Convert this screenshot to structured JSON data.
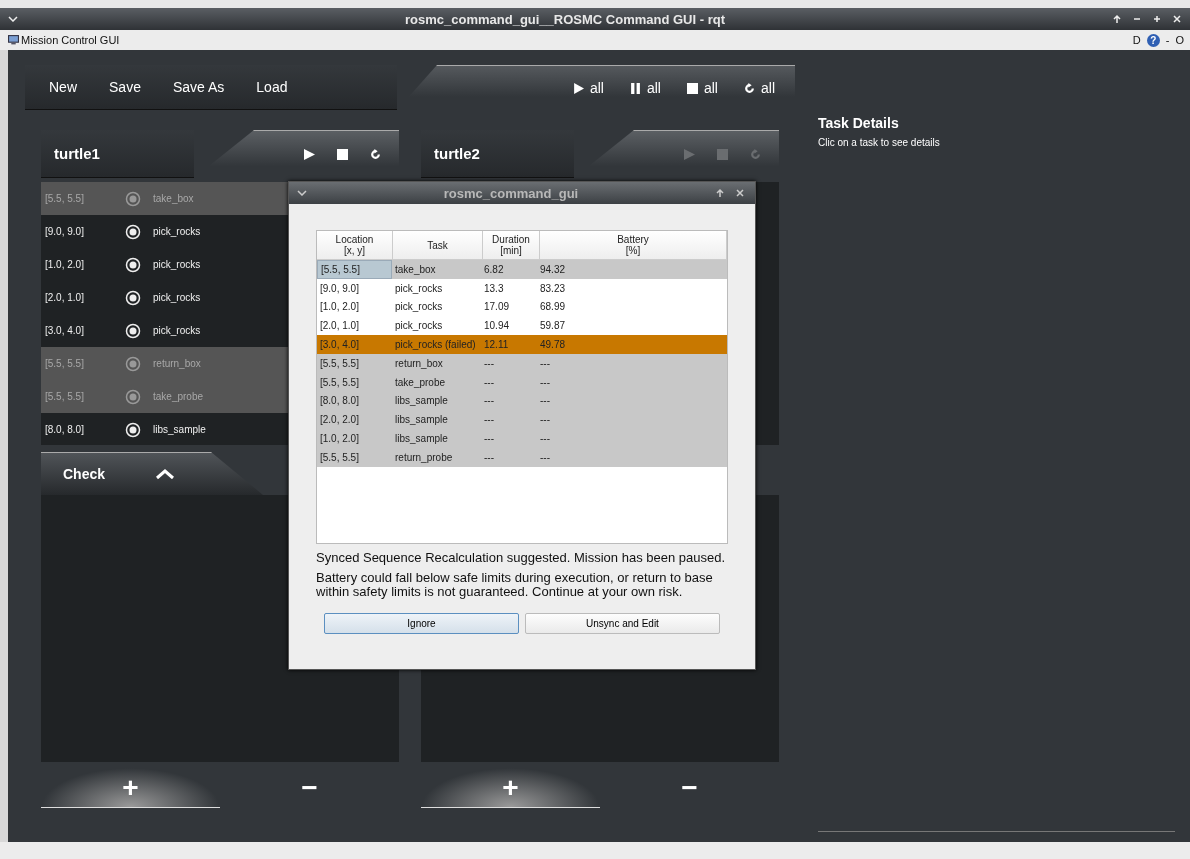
{
  "window": {
    "title": "rosmc_command_gui__ROSMC Command GUI - rqt"
  },
  "plugin_bar": {
    "title": "Mission Control GUI",
    "items": [
      {
        "kind": "text",
        "label": "D"
      },
      {
        "kind": "help",
        "label": "?"
      },
      {
        "kind": "text",
        "label": "-"
      },
      {
        "kind": "text",
        "label": "O"
      }
    ]
  },
  "toolbar": {
    "file_buttons": [
      "New",
      "Save",
      "Save As",
      "Load"
    ],
    "run_all": [
      {
        "kind": "play",
        "label": "all"
      },
      {
        "kind": "pause",
        "label": "all"
      },
      {
        "kind": "stop",
        "label": "all"
      },
      {
        "kind": "restart",
        "label": "all"
      }
    ]
  },
  "panels": [
    {
      "name": "turtle1",
      "disabled": false,
      "check_label": "Check",
      "add": "+",
      "remove": "−",
      "tasks": [
        {
          "location": "[5.5, 5.5]",
          "task": "take_box",
          "greyed": true
        },
        {
          "location": "[9.0, 9.0]",
          "task": "pick_rocks",
          "greyed": false
        },
        {
          "location": "[1.0, 2.0]",
          "task": "pick_rocks",
          "greyed": false
        },
        {
          "location": "[2.0, 1.0]",
          "task": "pick_rocks",
          "greyed": false
        },
        {
          "location": "[3.0, 4.0]",
          "task": "pick_rocks",
          "greyed": false
        },
        {
          "location": "[5.5, 5.5]",
          "task": "return_box",
          "greyed": true
        },
        {
          "location": "[5.5, 5.5]",
          "task": "take_probe",
          "greyed": true
        },
        {
          "location": "[8.0, 8.0]",
          "task": "libs_sample",
          "greyed": false
        }
      ]
    },
    {
      "name": "turtle2",
      "disabled": true,
      "add": "+",
      "remove": "−"
    }
  ],
  "task_details": {
    "title": "Task Details",
    "hint": "Clic on a task to see details"
  },
  "dialog": {
    "title": "rosmc_command_gui",
    "columns": [
      {
        "label": "Location",
        "unit": "[x, y]"
      },
      {
        "label": "Task"
      },
      {
        "label": "Duration",
        "unit": "[min]"
      },
      {
        "label": "Battery",
        "unit": "[%]"
      }
    ],
    "rows": [
      {
        "location": "[5.5, 5.5]",
        "task": "take_box",
        "duration": "6.82",
        "battery": "94.32",
        "color": "#c8c8c8",
        "selected": true
      },
      {
        "location": "[9.0, 9.0]",
        "task": "pick_rocks",
        "duration": "13.3",
        "battery": "83.23",
        "color": "#ffffff",
        "selected": false
      },
      {
        "location": "[1.0, 2.0]",
        "task": "pick_rocks",
        "duration": "17.09",
        "battery": "68.99",
        "color": "#ffffff",
        "selected": false
      },
      {
        "location": "[2.0, 1.0]",
        "task": "pick_rocks",
        "duration": "10.94",
        "battery": "59.87",
        "color": "#ffffff",
        "selected": false
      },
      {
        "location": "[3.0, 4.0]",
        "task": "pick_rocks (failed)",
        "duration": "12.11",
        "battery": "49.78",
        "color": "#c87800",
        "selected": false
      },
      {
        "location": "[5.5, 5.5]",
        "task": "return_box",
        "duration": "---",
        "battery": "---",
        "color": "#c8c8c8",
        "selected": false
      },
      {
        "location": "[5.5, 5.5]",
        "task": "take_probe",
        "duration": "---",
        "battery": "---",
        "color": "#c8c8c8",
        "selected": false
      },
      {
        "location": "[8.0, 8.0]",
        "task": "libs_sample",
        "duration": "---",
        "battery": "---",
        "color": "#c8c8c8",
        "selected": false
      },
      {
        "location": "[2.0, 2.0]",
        "task": "libs_sample",
        "duration": "---",
        "battery": "---",
        "color": "#c8c8c8",
        "selected": false
      },
      {
        "location": "[1.0, 2.0]",
        "task": "libs_sample",
        "duration": "---",
        "battery": "---",
        "color": "#c8c8c8",
        "selected": false
      },
      {
        "location": "[5.5, 5.5]",
        "task": "return_probe",
        "duration": "---",
        "battery": "---",
        "color": "#c8c8c8",
        "selected": false
      }
    ],
    "message": "Synced Sequence Recalculation suggested. Mission has been paused.",
    "warning": "Battery could fall below safe limits during execution, or return to base within safety limits is not guaranteed. Continue at your own risk.",
    "buttons": [
      {
        "label": "Ignore",
        "default": true
      },
      {
        "label": "Unsync and Edit",
        "default": false
      }
    ]
  }
}
